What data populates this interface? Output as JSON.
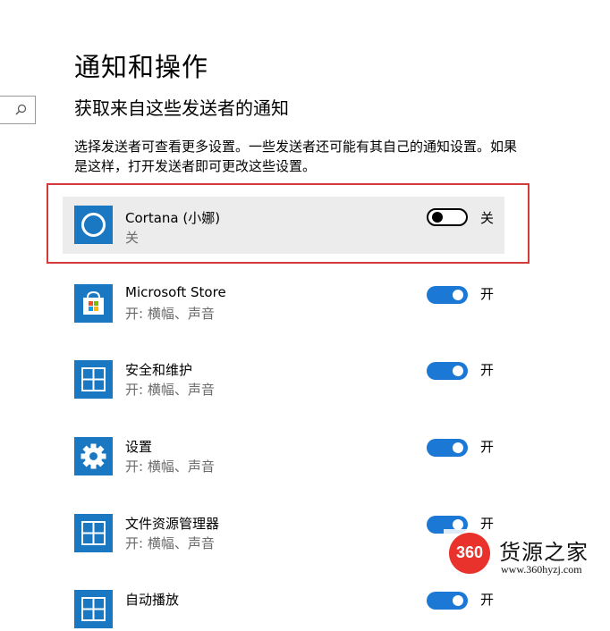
{
  "header": {
    "title": "通知和操作",
    "section_title": "获取来自这些发送者的通知",
    "description": "选择发送者可查看更多设置。一些发送者还可能有其自己的通知设置。如果是这样，打开发送者即可更改这些设置。"
  },
  "search": {
    "icon": "search-icon"
  },
  "colors": {
    "accent": "#1b78d4",
    "icon_bg": "#1a78c2",
    "highlight": "#d33b3b"
  },
  "senders": [
    {
      "name": "Cortana (小娜)",
      "status": "关",
      "toggle_state": "off",
      "toggle_label": "关",
      "icon": "cortana-ring-icon"
    },
    {
      "name": "Microsoft Store",
      "status": "开: 横幅、声音",
      "toggle_state": "on",
      "toggle_label": "开",
      "icon": "store-bag-icon"
    },
    {
      "name": "安全和维护",
      "status": "开: 横幅、声音",
      "toggle_state": "on",
      "toggle_label": "开",
      "icon": "window-grid-icon"
    },
    {
      "name": "设置",
      "status": "开: 横幅、声音",
      "toggle_state": "on",
      "toggle_label": "开",
      "icon": "gear-icon"
    },
    {
      "name": "文件资源管理器",
      "status": "开: 横幅、声音",
      "toggle_state": "on",
      "toggle_label": "开",
      "icon": "window-grid-icon"
    },
    {
      "name": "自动播放",
      "status": "",
      "toggle_state": "on",
      "toggle_label": "开",
      "icon": "window-grid-icon"
    }
  ],
  "watermark": {
    "badge": "360",
    "title": "货源之家",
    "url": "www.360hyzj.com"
  }
}
